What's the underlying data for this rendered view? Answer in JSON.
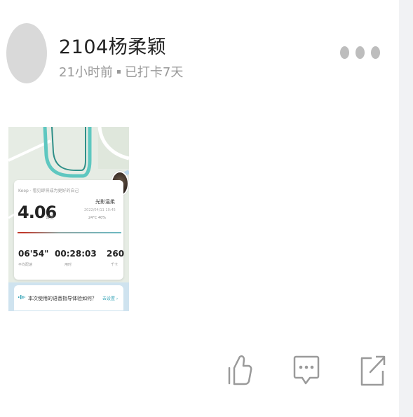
{
  "post": {
    "username": "2104杨柔颖",
    "time": "21小时前",
    "checkin": "已打卡7天"
  },
  "workout_card": {
    "source": "Keep · 看见即将成为更好的自己",
    "distance": "4.06",
    "distance_unit": "公里",
    "runner_name": "光影温柔",
    "date": "2022/04/11 10:45",
    "weather": "24°C   40%",
    "pace": "06'54\"",
    "pace_label": "平均配速",
    "duration": "00:28:03",
    "duration_label": "用时",
    "calories": "260",
    "calories_label": "千卡",
    "voice_question": "本次使用的语音指导体验如何？",
    "voice_action": "去设置 ›"
  },
  "actions": {
    "like": "thumbs-up-icon",
    "comment": "comment-icon",
    "share": "share-icon"
  },
  "colors": {
    "route": "#5ec7c0",
    "map_bg": "#e6ece4",
    "accent": "#3aa6b8",
    "meta_text": "#999999"
  }
}
